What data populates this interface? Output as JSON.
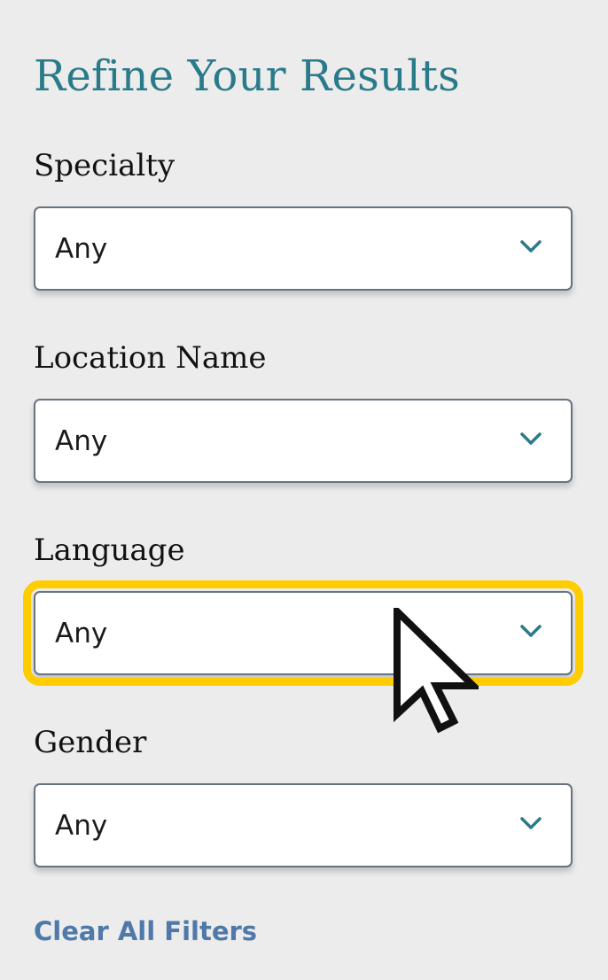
{
  "title": "Refine Your Results",
  "filters": [
    {
      "label": "Specialty",
      "value": "Any"
    },
    {
      "label": "Location Name",
      "value": "Any"
    },
    {
      "label": "Language",
      "value": "Any",
      "focused": true
    },
    {
      "label": "Gender",
      "value": "Any"
    }
  ],
  "actions": {
    "clear_all": "Clear All Filters"
  },
  "icons": {
    "chevron": "chevron-down-icon",
    "cursor": "mouse-pointer-icon"
  },
  "colors": {
    "accent": "#2a7b89",
    "focus_ring": "#ffcc00",
    "link": "#4f79a8",
    "background": "#ececec"
  }
}
